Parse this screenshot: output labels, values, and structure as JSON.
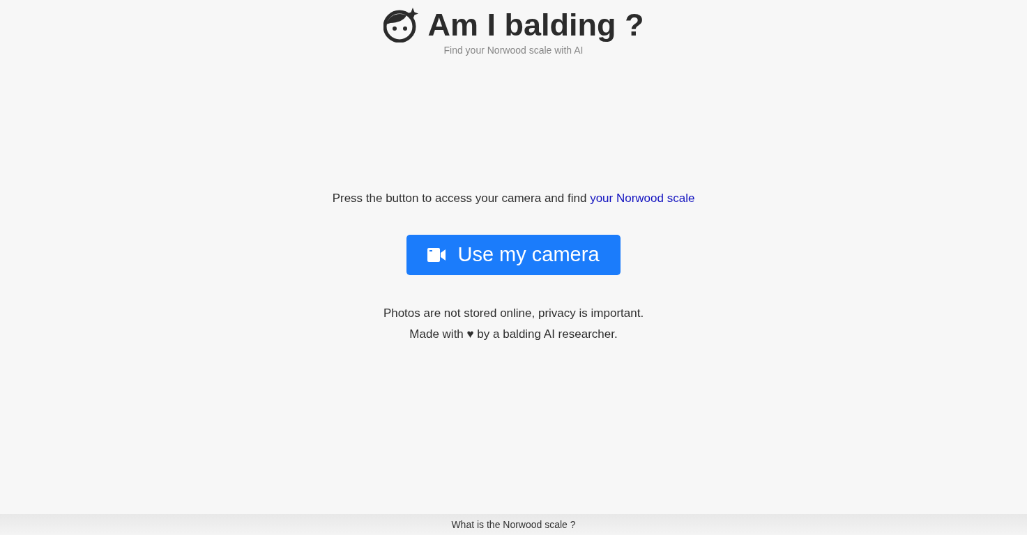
{
  "header": {
    "title": "Am I balding ?",
    "subtitle": "Find your Norwood scale with AI"
  },
  "intro": {
    "text": "Press the button to access your camera and find",
    "link": "your Norwood scale"
  },
  "camera_button": {
    "label": "Use my camera"
  },
  "notes": [
    "Photos are not stored online, privacy is important.",
    "Made with ♥ by a balding AI researcher."
  ],
  "bottom_bar": {
    "label": "What is the Norwood scale ?"
  }
}
